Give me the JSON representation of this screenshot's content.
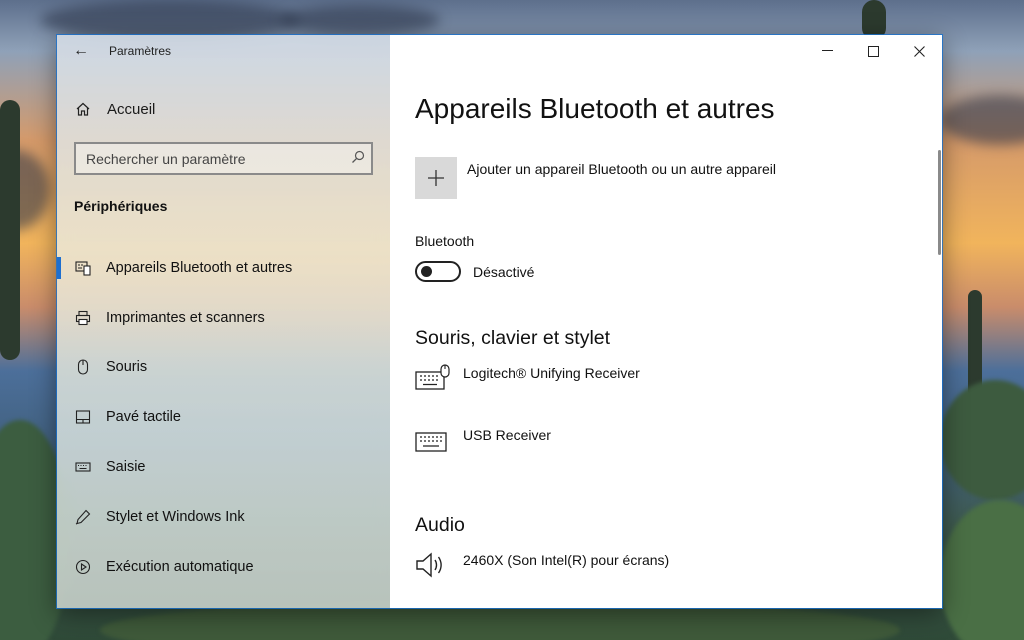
{
  "window": {
    "title": "Paramètres",
    "back_glyph": "←",
    "minimize_glyph": "—",
    "close_glyph": "✕"
  },
  "sidebar": {
    "home_label": "Accueil",
    "search_placeholder": "Rechercher un paramètre",
    "section_title": "Périphériques",
    "items": [
      {
        "label": "Appareils Bluetooth et autres",
        "icon": "bluetooth-devices-icon",
        "active": true
      },
      {
        "label": "Imprimantes et scanners",
        "icon": "printer-icon",
        "active": false
      },
      {
        "label": "Souris",
        "icon": "mouse-icon",
        "active": false
      },
      {
        "label": "Pavé tactile",
        "icon": "touchpad-icon",
        "active": false
      },
      {
        "label": "Saisie",
        "icon": "keyboard-icon",
        "active": false
      },
      {
        "label": "Stylet et Windows Ink",
        "icon": "pen-icon",
        "active": false
      },
      {
        "label": "Exécution automatique",
        "icon": "autoplay-icon",
        "active": false
      }
    ]
  },
  "main": {
    "title": "Appareils Bluetooth et autres",
    "add_device_label": "Ajouter un appareil Bluetooth ou un autre appareil",
    "bluetooth_label": "Bluetooth",
    "bluetooth_state": "Désactivé",
    "bluetooth_on": false,
    "mouse_section_title": "Souris, clavier et stylet",
    "mouse_devices": [
      {
        "name": "Logitech® Unifying Receiver",
        "icon": "keyboard-mouse-icon"
      },
      {
        "name": "USB Receiver",
        "icon": "keyboard-icon"
      }
    ],
    "audio_section_title": "Audio",
    "audio_devices": [
      {
        "name": "2460X (Son Intel(R) pour écrans)",
        "icon": "speaker-icon"
      }
    ]
  },
  "colors": {
    "accent": "#1e6fcf",
    "window_border": "#1870ce"
  }
}
